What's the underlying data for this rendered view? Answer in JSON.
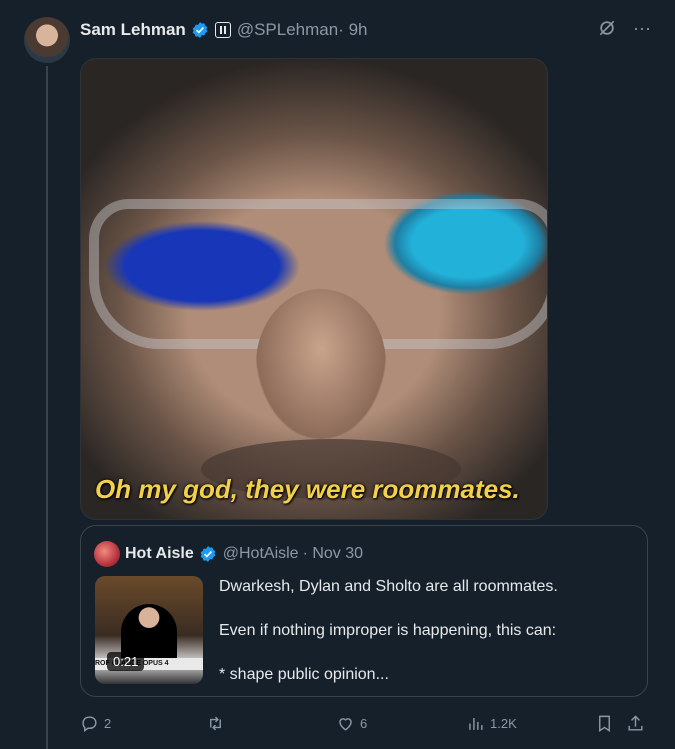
{
  "tweet": {
    "author_name": "Sam Lehman",
    "handle": "@SPLehman",
    "time": "· 9h",
    "media_caption": "Oh my god, they were roommates."
  },
  "quote": {
    "author_name": "Hot Aisle",
    "handle": "@HotAisle",
    "time": "· Nov 30",
    "video_duration": "0:21",
    "thumb_banner": "ROF CLAUDE OPUS 4",
    "text_lines": [
      "Dwarkesh, Dylan and Sholto are all roommates.",
      "Even if nothing improper is happening, this can:",
      "* shape public opinion..."
    ]
  },
  "actions": {
    "replies": "2",
    "retweets": "",
    "likes": "6",
    "views": "1.2K"
  },
  "colors": {
    "background": "#15202b",
    "verified": "#1d9bf0",
    "muted": "#8b98a5",
    "caption": "#f2d04a"
  }
}
